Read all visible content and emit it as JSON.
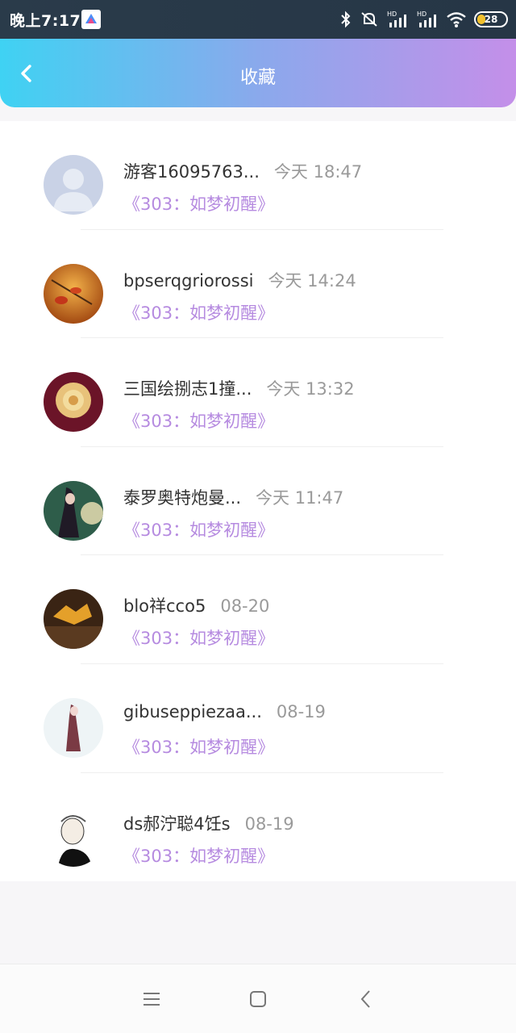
{
  "status_bar": {
    "time": "晚上7:17",
    "battery": "28"
  },
  "header": {
    "title": "收藏"
  },
  "favorites": [
    {
      "name": "游客16095763...",
      "time": "今天 18:47",
      "work": "《303：如梦初醒》"
    },
    {
      "name": "bpserqgriorossi",
      "time": "今天 14:24",
      "work": "《303：如梦初醒》"
    },
    {
      "name": "三国绘捌志1撞...",
      "time": "今天 13:32",
      "work": "《303：如梦初醒》"
    },
    {
      "name": "泰罗奥特炮曼...",
      "time": "今天 11:47",
      "work": "《303：如梦初醒》"
    },
    {
      "name": "blo祥cco5",
      "time": "08-20",
      "work": "《303：如梦初醒》"
    },
    {
      "name": "gibuseppiezaa...",
      "time": "08-19",
      "work": "《303：如梦初醒》"
    },
    {
      "name": "ds郝泞聪4饪s",
      "time": "08-19",
      "work": "《303：如梦初醒》"
    }
  ],
  "colors": {
    "accent_start": "#3fd2f3",
    "accent_end": "#c48fe9",
    "work_title": "#b68be0"
  }
}
